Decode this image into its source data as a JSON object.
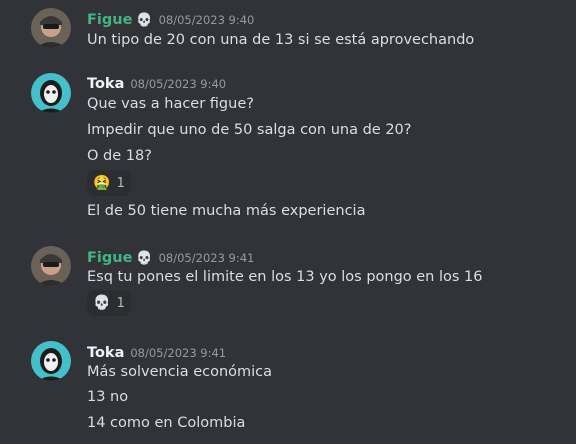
{
  "messages": [
    {
      "username": "Figue",
      "user_color": "#43b581",
      "badge_icon": "skull-icon",
      "timestamp": "08/05/2023 9:40",
      "lines": [
        "Un tipo de 20 con una de 13 si se está aprovechando"
      ]
    },
    {
      "username": "Toka",
      "user_color": "#f2f3f5",
      "timestamp": "08/05/2023 9:40",
      "lines": [
        "Que vas a hacer figue?",
        "Impedir que uno de 50 salga con una de 20?",
        "O de 18?",
        "El de 50 tiene mucha más experiencia"
      ],
      "reaction": {
        "icon": "nauseated-face-icon",
        "glyph": "🤮",
        "count": "1"
      }
    },
    {
      "username": "Figue",
      "user_color": "#43b581",
      "badge_icon": "skull-icon",
      "timestamp": "08/05/2023 9:41",
      "lines": [
        "Esq tu pones el limite en los 13 yo los pongo en los 16"
      ],
      "reaction": {
        "icon": "skull-icon",
        "glyph": "💀",
        "count": "1"
      }
    },
    {
      "username": "Toka",
      "user_color": "#f2f3f5",
      "timestamp": "08/05/2023 9:41",
      "lines": [
        "Más solvencia económica",
        "13 no",
        "14 como en Colombia"
      ]
    }
  ]
}
